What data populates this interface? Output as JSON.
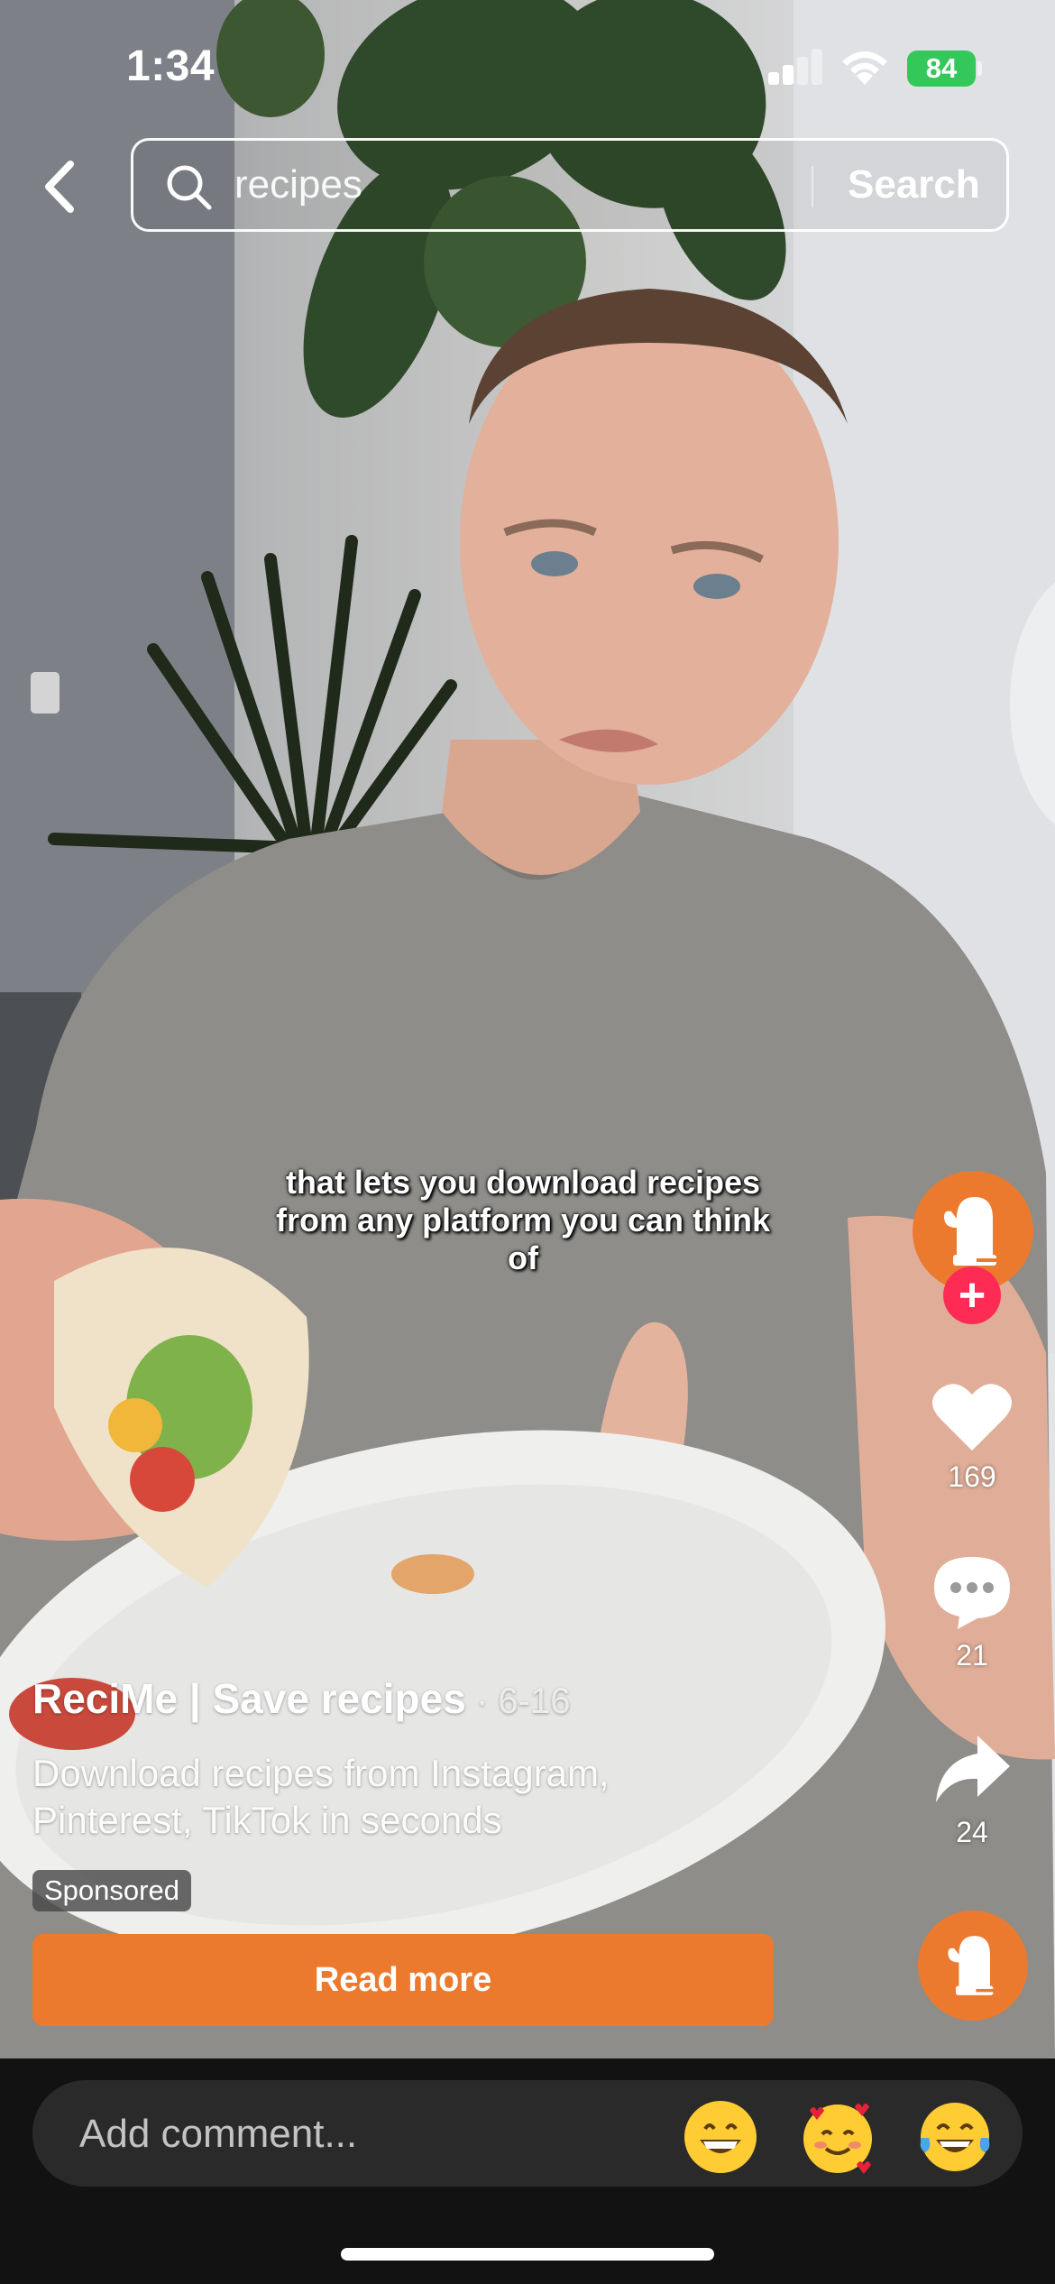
{
  "status_bar": {
    "time": "1:34",
    "battery_level": "84",
    "battery_color": "#34c759"
  },
  "header": {
    "back_icon": "chevron-left-icon",
    "search_query": "recipes",
    "search_button_label": "Search"
  },
  "video": {
    "caption": "that lets you download recipes from any platform you can think of"
  },
  "actions": {
    "likes": "169",
    "comments": "21",
    "shares": "24",
    "follow_symbol": "+",
    "brand_color": "#ec7a2e",
    "follow_color": "#fe2c55"
  },
  "ad": {
    "title": "ReciMe | Save recipes",
    "date": " · 6-16",
    "description": "Download recipes from Instagram, Pinterest, TikTok in seconds",
    "sponsored_label": "Sponsored",
    "cta_label": "Read more"
  },
  "comment_bar": {
    "placeholder": "Add comment...",
    "emojis": [
      "grinning-face",
      "smiling-face-with-hearts",
      "tears-of-joy"
    ]
  }
}
